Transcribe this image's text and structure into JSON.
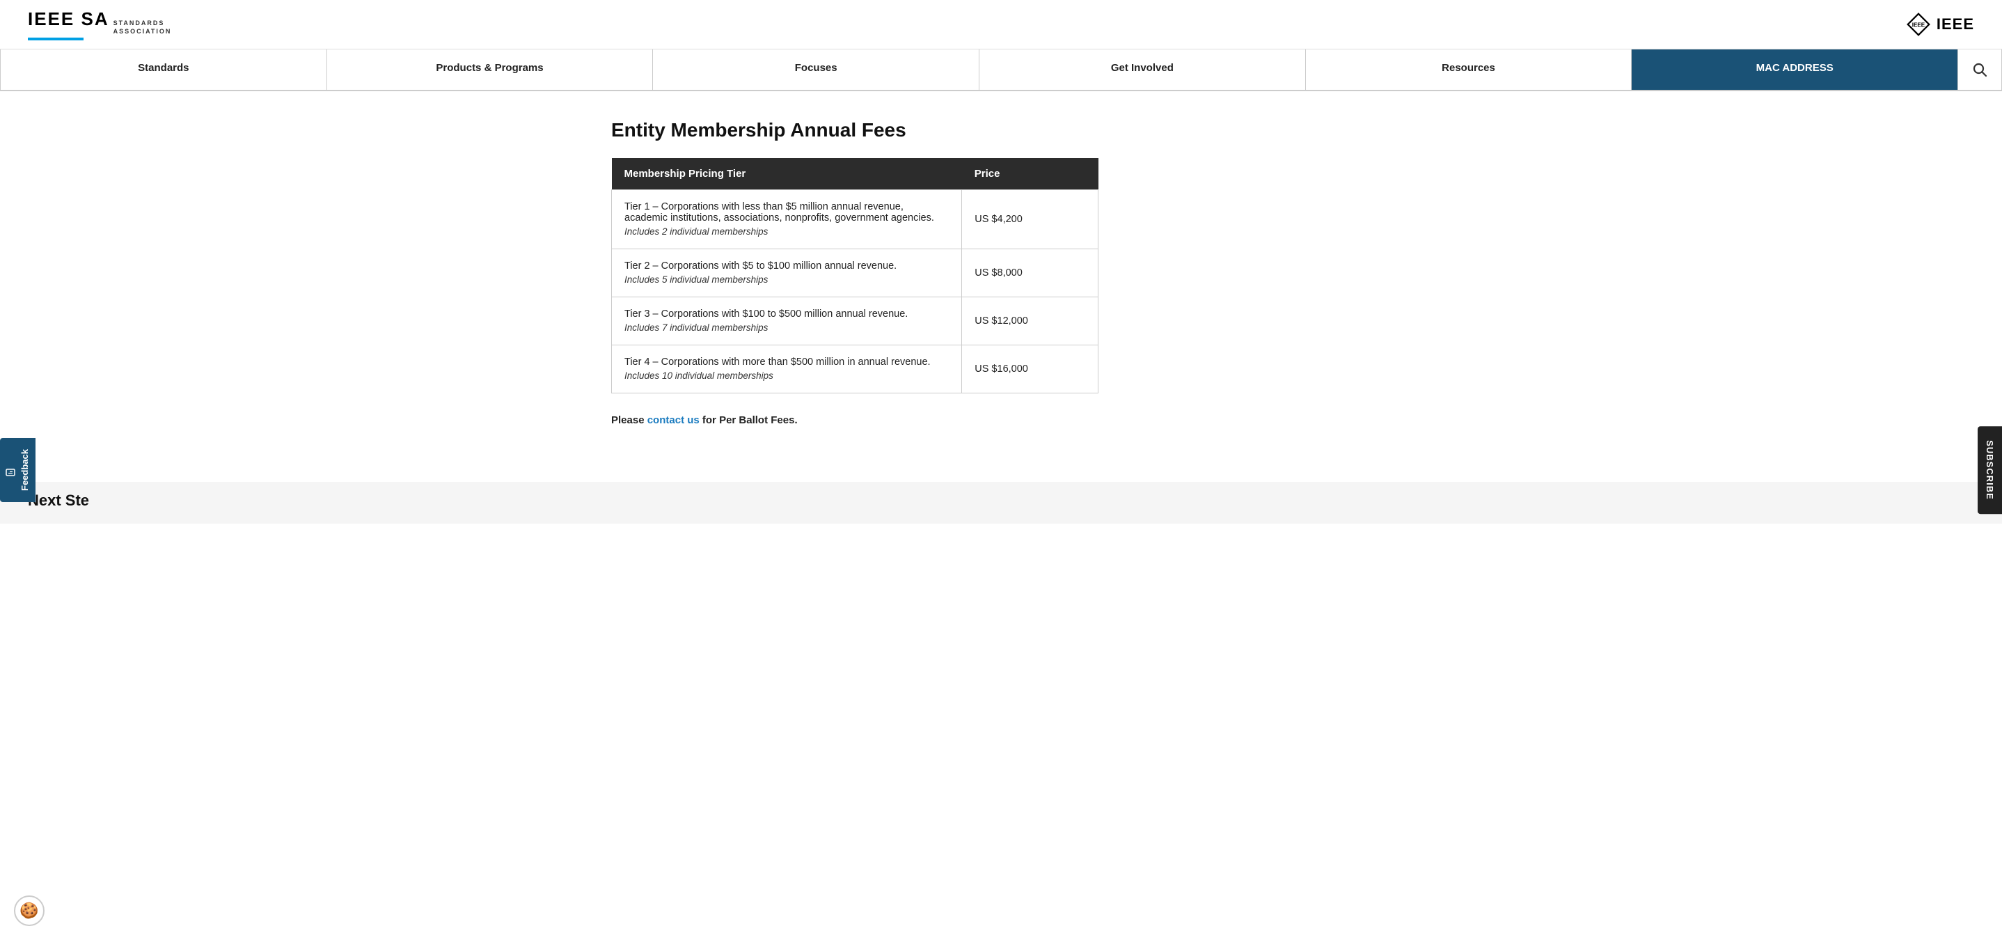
{
  "header": {
    "logo_ieee_sa": "IEEE SA",
    "logo_standards_line1": "STANDARDS",
    "logo_standards_line2": "ASSOCIATION",
    "ieee_logo_text": "IEEE"
  },
  "nav": {
    "items": [
      {
        "label": "Standards",
        "id": "standards",
        "active": false
      },
      {
        "label": "Products & Programs",
        "id": "products-programs",
        "active": false
      },
      {
        "label": "Focuses",
        "id": "focuses",
        "active": false
      },
      {
        "label": "Get Involved",
        "id": "get-involved",
        "active": false
      },
      {
        "label": "Resources",
        "id": "resources",
        "active": false
      },
      {
        "label": "MAC ADDRESS",
        "id": "mac-address",
        "active": true
      }
    ]
  },
  "page": {
    "title": "Entity Membership Annual Fees",
    "table": {
      "header_tier": "Membership Pricing Tier",
      "header_price": "Price",
      "rows": [
        {
          "tier_description": "Tier 1 – Corporations with less than $5 million annual revenue, academic institutions, associations, nonprofits, government agencies.",
          "tier_includes": "Includes 2 individual memberships",
          "price": "US $4,200"
        },
        {
          "tier_description": "Tier 2 – Corporations with $5 to $100 million annual revenue.",
          "tier_includes": "Includes 5 individual memberships",
          "price": "US $8,000"
        },
        {
          "tier_description": "Tier 3 – Corporations with $100 to $500 million annual revenue.",
          "tier_includes": "Includes 7 individual memberships",
          "price": "US $12,000"
        },
        {
          "tier_description": "Tier 4 – Corporations with more than $500 million in annual revenue.",
          "tier_includes": "Includes 10 individual memberships",
          "price": "US $16,000"
        }
      ]
    },
    "ballot_note_prefix": "Please ",
    "ballot_note_link": "contact us",
    "ballot_note_suffix": " for Per Ballot Fees.",
    "next_steps_label": "Next Ste"
  },
  "sidebar": {
    "feedback_label": "Feedback",
    "subscribe_label": "SUBSCRIBE"
  },
  "cookie_icon": "🍪"
}
